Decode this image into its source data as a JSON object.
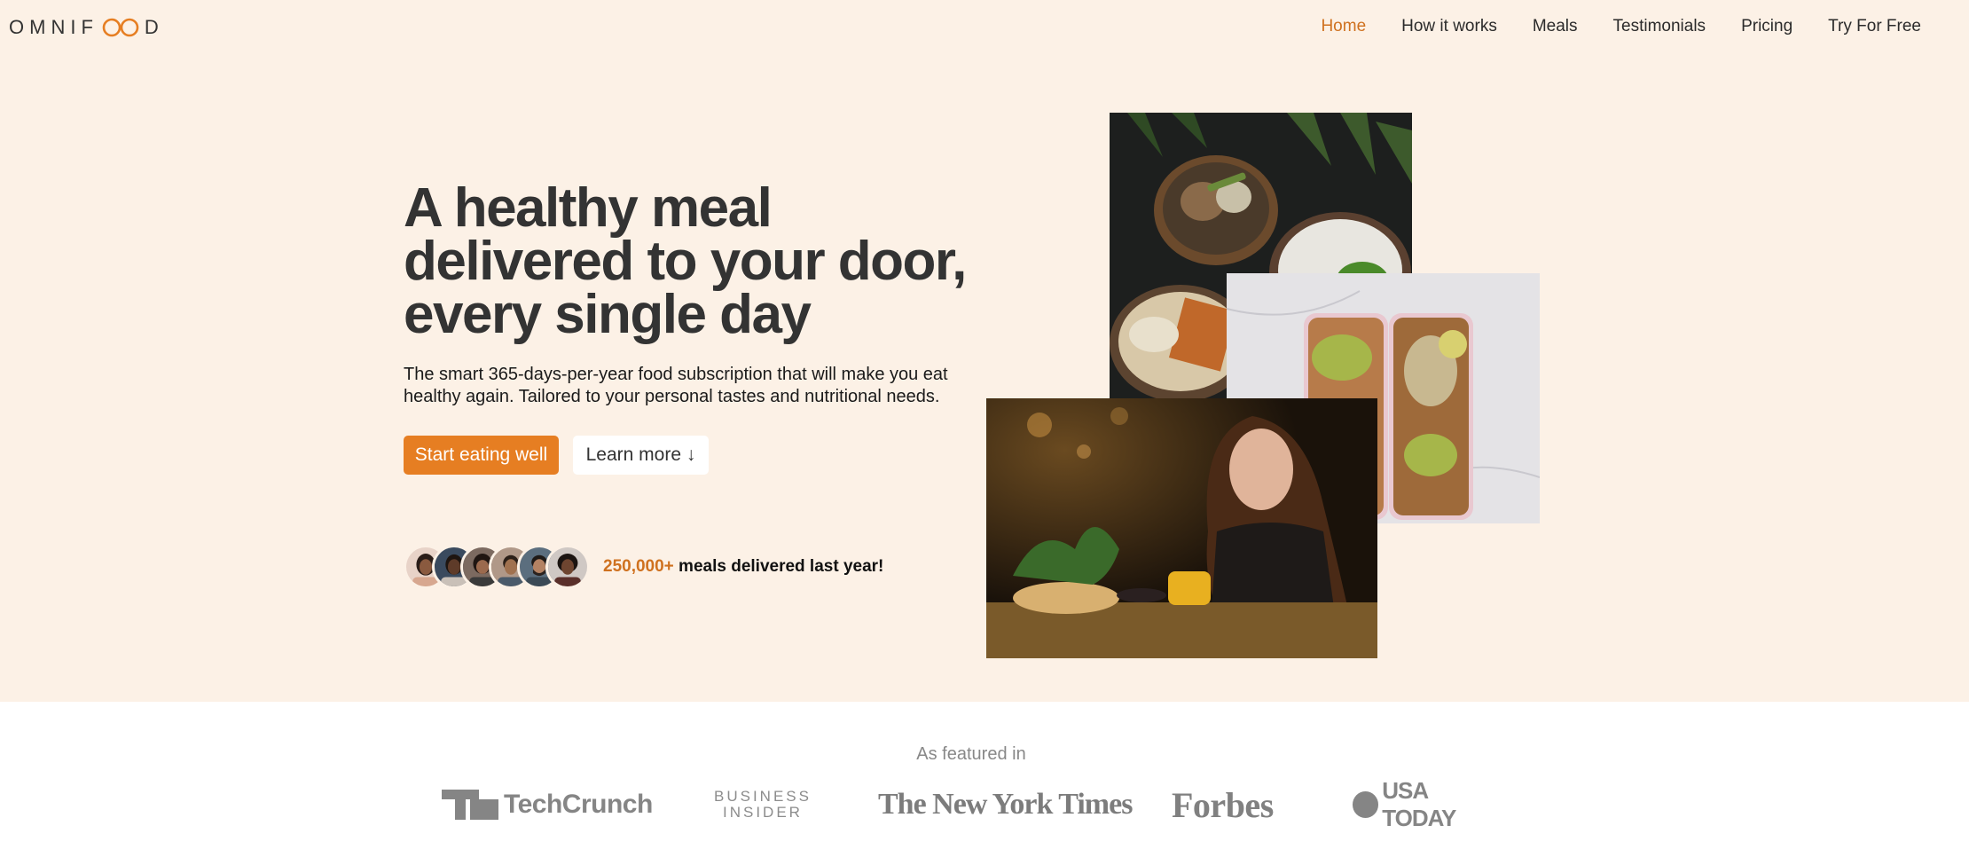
{
  "header": {
    "logo_prefix": "OMNIF",
    "logo_suffix": "D",
    "nav": [
      "Home",
      "How it works",
      "Meals",
      "Testimonials",
      "Pricing",
      "Try For Free"
    ],
    "active_nav": "Home"
  },
  "hero": {
    "title_lines": [
      "A healthy meal",
      "delivered to your door,",
      "every single day"
    ],
    "description": "The smart 365-days-per-year food subscription that will make you eat healthy again. Tailored to your personal tastes and nutritional needs.",
    "primary_button": "Start eating well",
    "secondary_button": "Learn more ↓",
    "delivered_count": "250,000+",
    "delivered_text": " meals delivered last year!"
  },
  "featured": {
    "title": "As featured in",
    "logos": {
      "techcrunch": "TechCrunch",
      "business_insider_line1": "BUSINESS",
      "business_insider_line2": "INSIDER",
      "nyt": "The New York Times",
      "forbes": "Forbes",
      "usa_today": "USA TODAY"
    }
  },
  "colors": {
    "accent": "#e67e22",
    "accent_text": "#cf711f",
    "hero_background": "#fcf1e6",
    "heading": "#333333"
  },
  "icons": {
    "logo_mark": "infinity-loop-icon",
    "avatars": "customer-avatar-icon"
  }
}
